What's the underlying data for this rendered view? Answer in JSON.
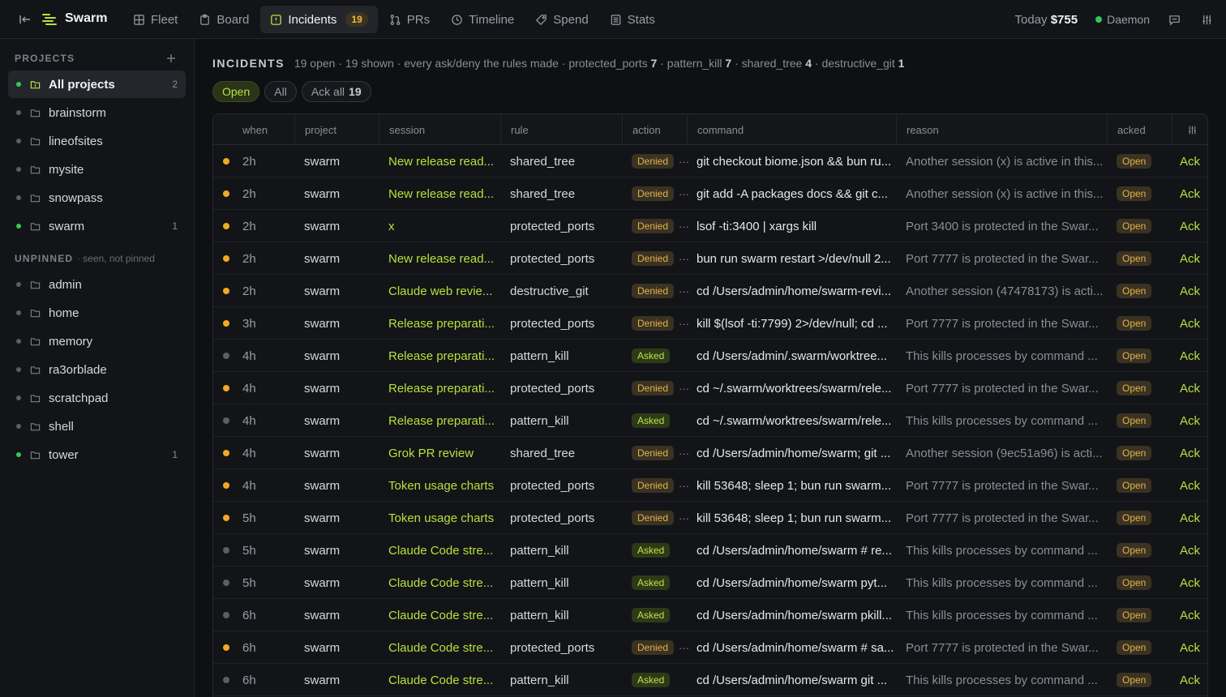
{
  "app": {
    "title": "Swarm"
  },
  "nav": {
    "tabs": [
      {
        "label": "Fleet",
        "icon": "grid-icon"
      },
      {
        "label": "Board",
        "icon": "clipboard-icon"
      },
      {
        "label": "Incidents",
        "icon": "alert-square-icon",
        "badge": "19",
        "active": true
      },
      {
        "label": "PRs",
        "icon": "git-pull-request-icon"
      },
      {
        "label": "Timeline",
        "icon": "clock-icon"
      },
      {
        "label": "Spend",
        "icon": "tag-icon"
      },
      {
        "label": "Stats",
        "icon": "list-icon"
      }
    ]
  },
  "topright": {
    "today_label": "Today",
    "today_amount": "$755",
    "daemon_label": "Daemon"
  },
  "sidebar": {
    "projects_heading": "PROJECTS",
    "projects": [
      {
        "label": "All projects",
        "count": "2",
        "active": true,
        "status": "green"
      },
      {
        "label": "brainstorm",
        "count": "",
        "status": "grey"
      },
      {
        "label": "lineofsites",
        "count": "",
        "status": "grey"
      },
      {
        "label": "mysite",
        "count": "",
        "status": "grey"
      },
      {
        "label": "snowpass",
        "count": "",
        "status": "grey"
      },
      {
        "label": "swarm",
        "count": "1",
        "status": "green"
      }
    ],
    "unpinned_heading": "UNPINNED",
    "unpinned_sub": "· seen, not pinned",
    "unpinned": [
      {
        "label": "admin",
        "count": "",
        "status": "grey"
      },
      {
        "label": "home",
        "count": "",
        "status": "grey"
      },
      {
        "label": "memory",
        "count": "",
        "status": "grey"
      },
      {
        "label": "ra3orblade",
        "count": "",
        "status": "grey"
      },
      {
        "label": "scratchpad",
        "count": "",
        "status": "grey"
      },
      {
        "label": "shell",
        "count": "",
        "status": "grey"
      },
      {
        "label": "tower",
        "count": "1",
        "status": "green"
      }
    ]
  },
  "main": {
    "heading": "INCIDENTS",
    "summary_prefix": "19 open · 19 shown · every ask/deny the rules made · protected_ports",
    "summary_pp": "7",
    "summary_pk_label": "· pattern_kill",
    "summary_pk": "7",
    "summary_st_label": "· shared_tree",
    "summary_st": "4",
    "summary_dg_label": "· destructive_git",
    "summary_dg": "1",
    "filters": {
      "open": "Open",
      "all": "All",
      "ack_all": "Ack all",
      "ack_all_count": "19"
    },
    "columns": [
      "when",
      "project",
      "session",
      "rule",
      "action",
      "command",
      "reason",
      "acked"
    ],
    "rows": [
      {
        "status": "amber",
        "when": "2h",
        "project": "swarm",
        "session": "New release read...",
        "rule": "shared_tree",
        "action": "Denied",
        "command": "git checkout biome.json && bun ru...",
        "reason": "Another session (x) is active in this...",
        "acked": "Open",
        "ack": "Ack"
      },
      {
        "status": "amber",
        "when": "2h",
        "project": "swarm",
        "session": "New release read...",
        "rule": "shared_tree",
        "action": "Denied",
        "command": "git add -A packages docs && git c...",
        "reason": "Another session (x) is active in this...",
        "acked": "Open",
        "ack": "Ack"
      },
      {
        "status": "amber",
        "when": "2h",
        "project": "swarm",
        "session": "x",
        "rule": "protected_ports",
        "action": "Denied",
        "command": "lsof -ti:3400 | xargs kill",
        "reason": "Port 3400 is protected in the Swar...",
        "acked": "Open",
        "ack": "Ack"
      },
      {
        "status": "amber",
        "when": "2h",
        "project": "swarm",
        "session": "New release read...",
        "rule": "protected_ports",
        "action": "Denied",
        "command": "bun run swarm restart >/dev/null 2...",
        "reason": "Port 7777 is protected in the Swar...",
        "acked": "Open",
        "ack": "Ack"
      },
      {
        "status": "amber",
        "when": "2h",
        "project": "swarm",
        "session": "Claude web revie...",
        "rule": "destructive_git",
        "action": "Denied",
        "command": "cd /Users/admin/home/swarm-revi...",
        "reason": "Another session (47478173) is acti...",
        "acked": "Open",
        "ack": "Ack"
      },
      {
        "status": "amber",
        "when": "3h",
        "project": "swarm",
        "session": "Release preparati...",
        "rule": "protected_ports",
        "action": "Denied",
        "command": "kill $(lsof -ti:7799) 2>/dev/null; cd ...",
        "reason": "Port 7777 is protected in the Swar...",
        "acked": "Open",
        "ack": "Ack"
      },
      {
        "status": "grey",
        "when": "4h",
        "project": "swarm",
        "session": "Release preparati...",
        "rule": "pattern_kill",
        "action": "Asked",
        "command": "cd /Users/admin/.swarm/worktree...",
        "reason": "This kills processes by command ...",
        "acked": "Open",
        "ack": "Ack"
      },
      {
        "status": "amber",
        "when": "4h",
        "project": "swarm",
        "session": "Release preparati...",
        "rule": "protected_ports",
        "action": "Denied",
        "command": "cd ~/.swarm/worktrees/swarm/rele...",
        "reason": "Port 7777 is protected in the Swar...",
        "acked": "Open",
        "ack": "Ack"
      },
      {
        "status": "grey",
        "when": "4h",
        "project": "swarm",
        "session": "Release preparati...",
        "rule": "pattern_kill",
        "action": "Asked",
        "command": "cd ~/.swarm/worktrees/swarm/rele...",
        "reason": "This kills processes by command ...",
        "acked": "Open",
        "ack": "Ack"
      },
      {
        "status": "amber",
        "when": "4h",
        "project": "swarm",
        "session": "Grok PR review",
        "rule": "shared_tree",
        "action": "Denied",
        "command": "cd /Users/admin/home/swarm; git ...",
        "reason": "Another session (9ec51a96) is acti...",
        "acked": "Open",
        "ack": "Ack"
      },
      {
        "status": "amber",
        "when": "4h",
        "project": "swarm",
        "session": "Token usage charts",
        "rule": "protected_ports",
        "action": "Denied",
        "command": "kill 53648; sleep 1; bun run swarm...",
        "reason": "Port 7777 is protected in the Swar...",
        "acked": "Open",
        "ack": "Ack"
      },
      {
        "status": "amber",
        "when": "5h",
        "project": "swarm",
        "session": "Token usage charts",
        "rule": "protected_ports",
        "action": "Denied",
        "command": "kill 53648; sleep 1; bun run swarm...",
        "reason": "Port 7777 is protected in the Swar...",
        "acked": "Open",
        "ack": "Ack"
      },
      {
        "status": "grey",
        "when": "5h",
        "project": "swarm",
        "session": "Claude Code stre...",
        "rule": "pattern_kill",
        "action": "Asked",
        "command": "cd /Users/admin/home/swarm # re...",
        "reason": "This kills processes by command ...",
        "acked": "Open",
        "ack": "Ack"
      },
      {
        "status": "grey",
        "when": "5h",
        "project": "swarm",
        "session": "Claude Code stre...",
        "rule": "pattern_kill",
        "action": "Asked",
        "command": "cd /Users/admin/home/swarm pyt...",
        "reason": "This kills processes by command ...",
        "acked": "Open",
        "ack": "Ack"
      },
      {
        "status": "grey",
        "when": "6h",
        "project": "swarm",
        "session": "Claude Code stre...",
        "rule": "pattern_kill",
        "action": "Asked",
        "command": "cd /Users/admin/home/swarm pkill...",
        "reason": "This kills processes by command ...",
        "acked": "Open",
        "ack": "Ack"
      },
      {
        "status": "amber",
        "when": "6h",
        "project": "swarm",
        "session": "Claude Code stre...",
        "rule": "protected_ports",
        "action": "Denied",
        "command": "cd /Users/admin/home/swarm # sa...",
        "reason": "Port 7777 is protected in the Swar...",
        "acked": "Open",
        "ack": "Ack"
      },
      {
        "status": "grey",
        "when": "6h",
        "project": "swarm",
        "session": "Claude Code stre...",
        "rule": "pattern_kill",
        "action": "Asked",
        "command": "cd /Users/admin/home/swarm git ...",
        "reason": "This kills processes by command ...",
        "acked": "Open",
        "ack": "Ack"
      }
    ]
  }
}
